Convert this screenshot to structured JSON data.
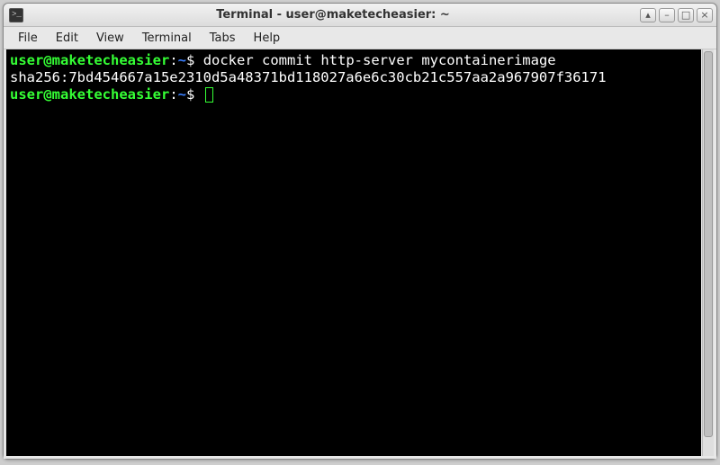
{
  "window": {
    "title": "Terminal - user@maketecheasier: ~"
  },
  "menubar": {
    "items": [
      "File",
      "Edit",
      "View",
      "Terminal",
      "Tabs",
      "Help"
    ]
  },
  "window_controls": {
    "up": "▴",
    "minimize": "–",
    "maximize": "□",
    "close": "×"
  },
  "prompt": {
    "user_host": "user@maketecheasier",
    "sep": ":",
    "path": "~",
    "symbol": "$"
  },
  "terminal": {
    "lines": [
      {
        "type": "cmd",
        "command": "docker commit http-server mycontainerimage"
      },
      {
        "type": "out",
        "text": "sha256:7bd454667a15e2310d5a48371bd118027a6e6c30cb21c557aa2a967907f36171"
      },
      {
        "type": "cmd",
        "command": "",
        "cursor": true
      }
    ]
  }
}
